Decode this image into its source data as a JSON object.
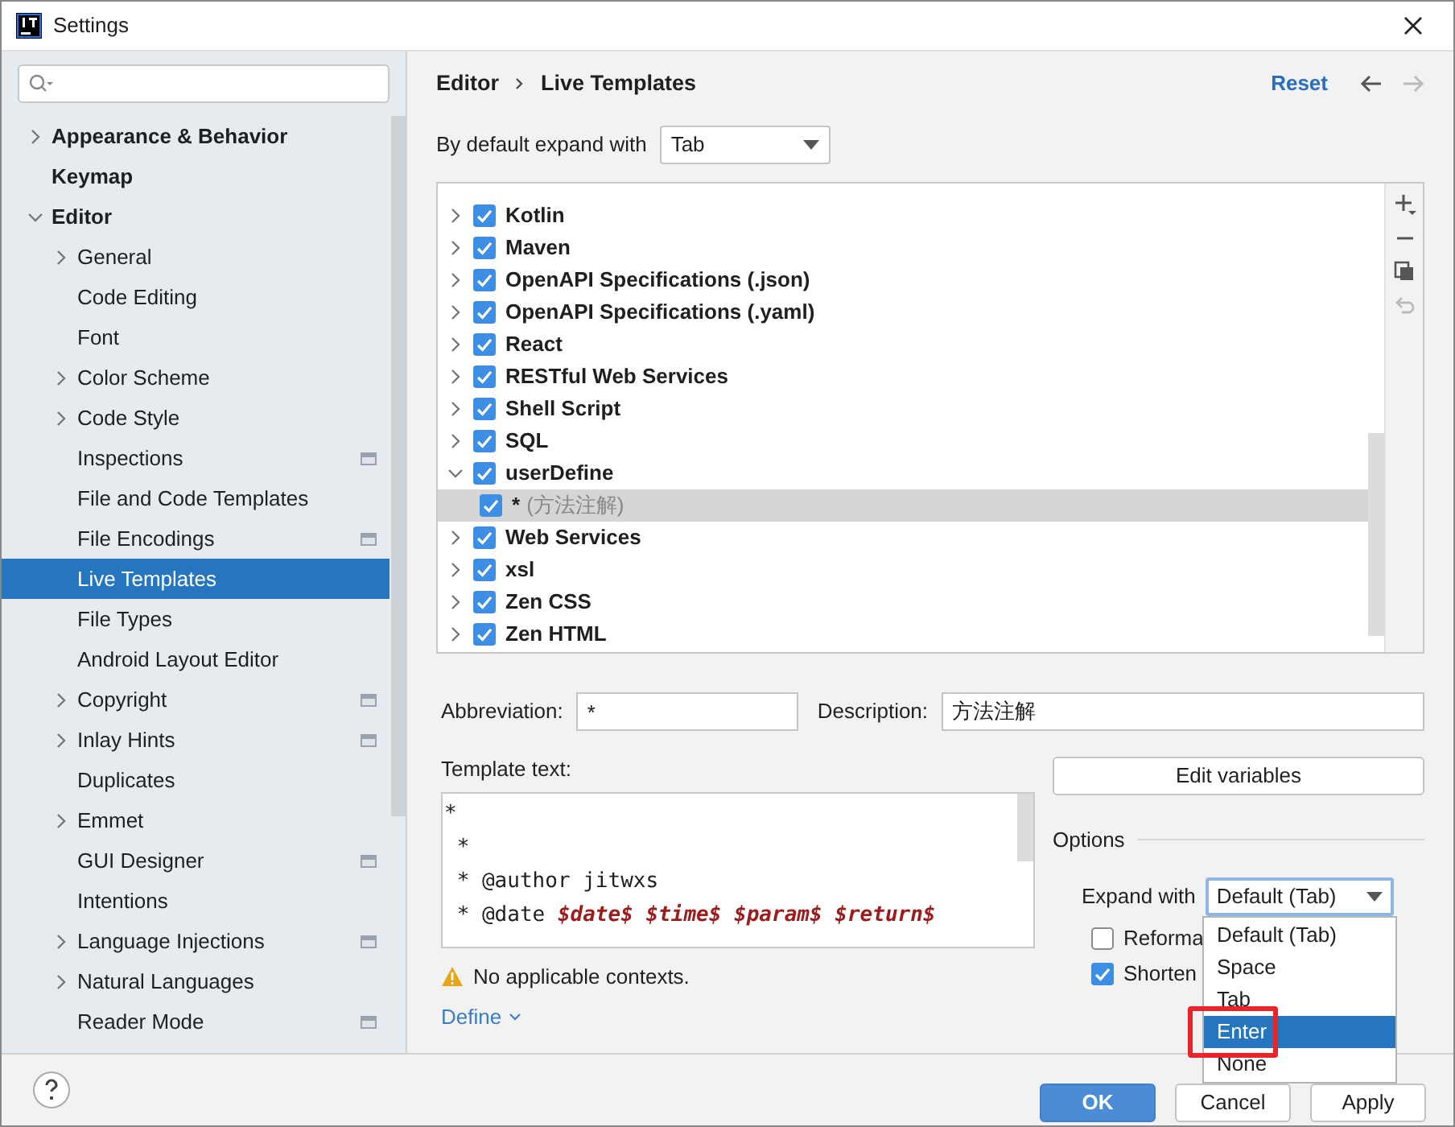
{
  "window": {
    "title": "Settings"
  },
  "sidebar": {
    "items": [
      {
        "label": "Appearance & Behavior",
        "expanded": false,
        "selected": false
      },
      {
        "label": "Keymap",
        "selected": false
      },
      {
        "label": "Editor",
        "expanded": true,
        "selected": false,
        "children": [
          {
            "label": "General",
            "expanded": false,
            "selected": false
          },
          {
            "label": "Code Editing",
            "selected": false
          },
          {
            "label": "Font",
            "selected": false
          },
          {
            "label": "Color Scheme",
            "expanded": false,
            "selected": false
          },
          {
            "label": "Code Style",
            "expanded": false,
            "selected": false
          },
          {
            "label": "Inspections",
            "selected": false,
            "project_badge": true
          },
          {
            "label": "File and Code Templates",
            "selected": false
          },
          {
            "label": "File Encodings",
            "selected": false,
            "project_badge": true
          },
          {
            "label": "Live Templates",
            "selected": true
          },
          {
            "label": "File Types",
            "selected": false
          },
          {
            "label": "Android Layout Editor",
            "selected": false
          },
          {
            "label": "Copyright",
            "expanded": false,
            "selected": false,
            "project_badge": true
          },
          {
            "label": "Inlay Hints",
            "expanded": false,
            "selected": false,
            "project_badge": true
          },
          {
            "label": "Duplicates",
            "selected": false
          },
          {
            "label": "Emmet",
            "expanded": false,
            "selected": false
          },
          {
            "label": "GUI Designer",
            "selected": false,
            "project_badge": true
          },
          {
            "label": "Intentions",
            "selected": false
          },
          {
            "label": "Language Injections",
            "expanded": false,
            "selected": false,
            "project_badge": true
          },
          {
            "label": "Natural Languages",
            "expanded": false,
            "selected": false
          },
          {
            "label": "Reader Mode",
            "selected": false,
            "project_badge": true
          }
        ]
      }
    ]
  },
  "breadcrumb": [
    "Editor",
    "Live Templates"
  ],
  "reset_link": "Reset",
  "default_expand": {
    "label": "By default expand with",
    "value": "Tab"
  },
  "template_groups": [
    {
      "label": "Kotlin",
      "checked": true,
      "expanded": false,
      "selected": false
    },
    {
      "label": "Maven",
      "checked": true,
      "expanded": false,
      "selected": false
    },
    {
      "label": "OpenAPI Specifications (.json)",
      "checked": true,
      "expanded": false,
      "selected": false
    },
    {
      "label": "OpenAPI Specifications (.yaml)",
      "checked": true,
      "expanded": false,
      "selected": false
    },
    {
      "label": "React",
      "checked": true,
      "expanded": false,
      "selected": false
    },
    {
      "label": "RESTful Web Services",
      "checked": true,
      "expanded": false,
      "selected": false
    },
    {
      "label": "Shell Script",
      "checked": true,
      "expanded": false,
      "selected": false
    },
    {
      "label": "SQL",
      "checked": true,
      "expanded": false,
      "selected": false
    },
    {
      "label": "userDefine",
      "checked": true,
      "expanded": true,
      "selected": false,
      "children": [
        {
          "label": "*",
          "description": "(方法注解)",
          "checked": true,
          "selected": true
        }
      ]
    },
    {
      "label": "Web Services",
      "checked": true,
      "expanded": false,
      "selected": false
    },
    {
      "label": "xsl",
      "checked": true,
      "expanded": false,
      "selected": false
    },
    {
      "label": "Zen CSS",
      "checked": true,
      "expanded": false,
      "selected": false
    },
    {
      "label": "Zen HTML",
      "checked": true,
      "expanded": false,
      "selected": false
    }
  ],
  "abbreviation": {
    "label": "Abbreviation:",
    "value": "*"
  },
  "description": {
    "label": "Description:",
    "value": "方法注解"
  },
  "template_text": {
    "label": "Template text:",
    "lines": [
      [
        {
          "kind": "text",
          "text": "*"
        }
      ],
      [
        {
          "kind": "text",
          "text": " *"
        }
      ],
      [
        {
          "kind": "text",
          "text": " * @author jitwxs"
        }
      ],
      [
        {
          "kind": "text",
          "text": " * @date "
        },
        {
          "kind": "variable",
          "text": "$date$ $time$ $param$ $return$"
        }
      ]
    ]
  },
  "warning": "No applicable contexts.",
  "define_link": "Define",
  "edit_variables_button": "Edit variables",
  "options": {
    "title": "Options",
    "expand_with": {
      "label": "Expand with",
      "value": "Default (Tab)"
    },
    "checkboxes": [
      {
        "label": "Reforma",
        "checked": false
      },
      {
        "label": "Shorten",
        "checked": true
      }
    ]
  },
  "dropdown_menu": [
    {
      "label": "Default (Tab)",
      "selected": false,
      "highlighted_box": false
    },
    {
      "label": "Space",
      "selected": false,
      "highlighted_box": false
    },
    {
      "label": "Tab",
      "selected": false,
      "highlighted_box": false
    },
    {
      "label": "Enter",
      "selected": true,
      "highlighted_box": true
    },
    {
      "label": "None",
      "selected": false,
      "highlighted_box": false
    }
  ],
  "buttons": [
    {
      "label": "OK",
      "kind": "primary"
    },
    {
      "label": "Cancel",
      "kind": "normal"
    },
    {
      "label": "Apply",
      "kind": "normal"
    }
  ]
}
